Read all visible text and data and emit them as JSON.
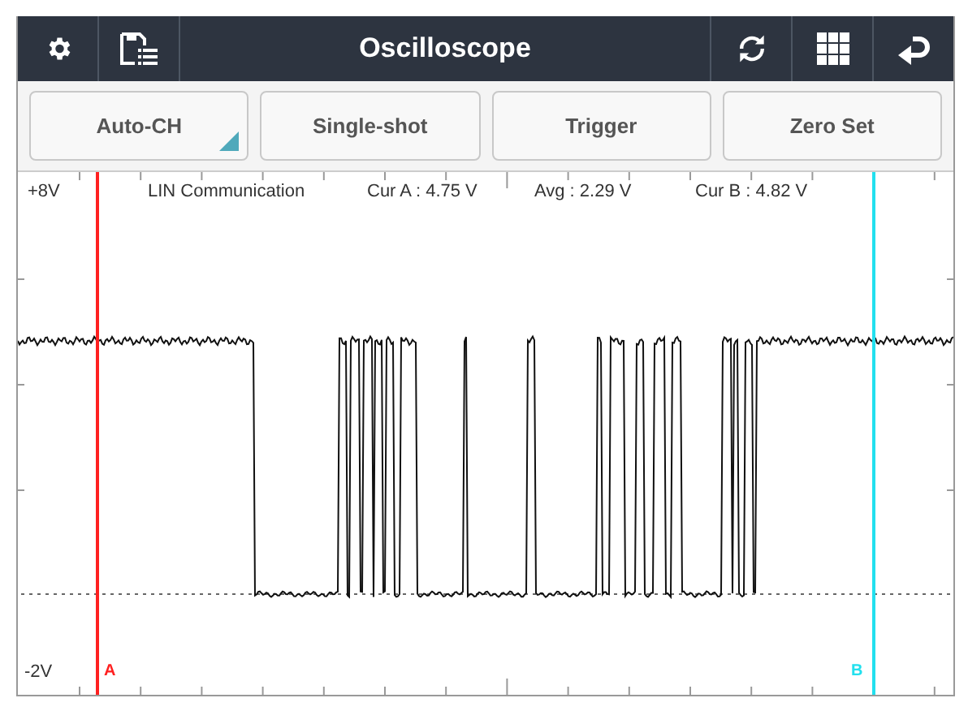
{
  "window": {
    "title": "Oscilloscope"
  },
  "toolbar": [
    {
      "label": "Auto-CH",
      "kind": "dropdown"
    },
    {
      "label": "Single-shot",
      "kind": "button"
    },
    {
      "label": "Trigger",
      "kind": "button"
    },
    {
      "label": "Zero Set",
      "kind": "button"
    }
  ],
  "plot": {
    "y_max_label": "+8V",
    "y_min_label": "-2V",
    "signal_name": "LIN Communication",
    "readings": [
      "Cur A : 4.75 V",
      "Avg : 2.29 V",
      "Cur B : 4.82 V"
    ],
    "cursors": [
      {
        "label": "A",
        "color": "#ff2020"
      },
      {
        "label": "B",
        "color": "#22e0ee"
      }
    ]
  }
}
